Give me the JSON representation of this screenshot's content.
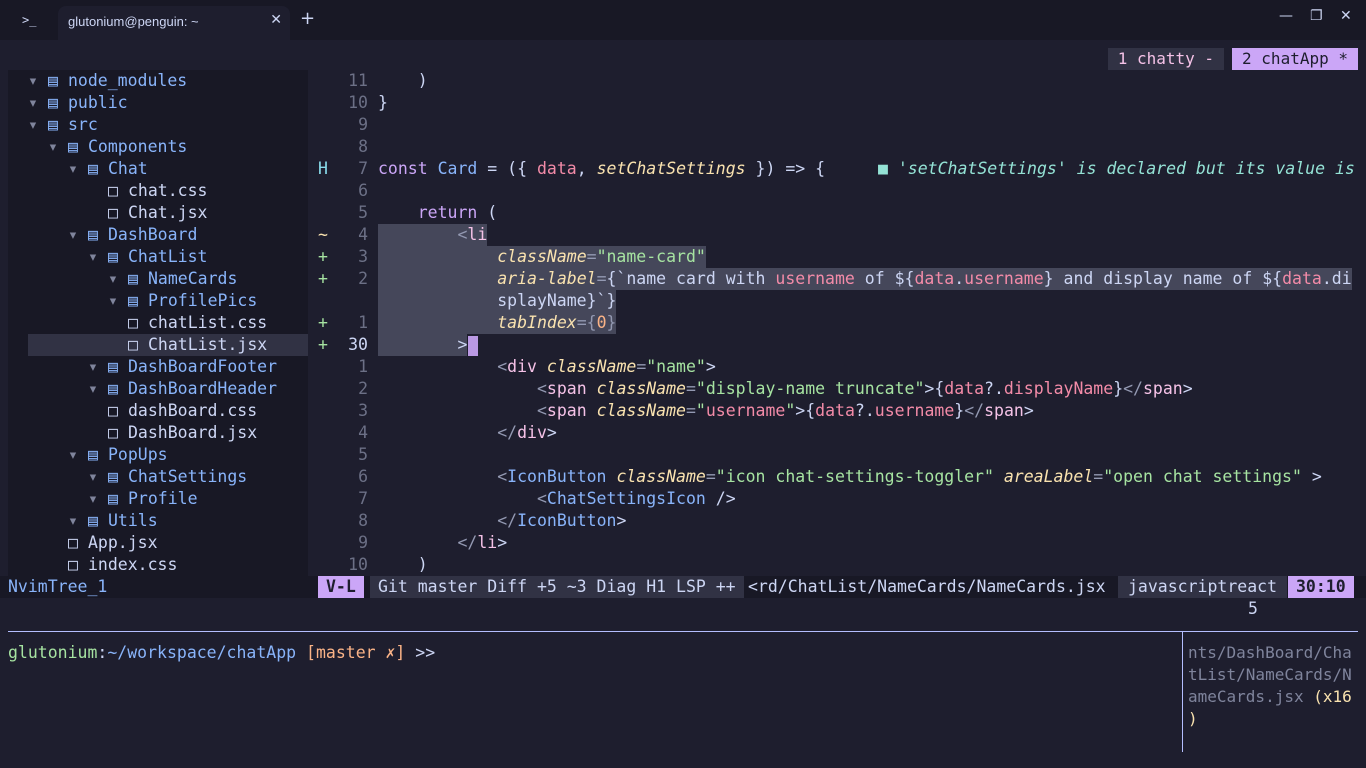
{
  "window": {
    "tab_title": "glutonium@penguin: ~",
    "terminal_icon": ">_",
    "close_glyph": "✕",
    "new_tab_glyph": "+",
    "minimize_glyph": "—",
    "maximize_glyph": "❐",
    "close_window_glyph": "✕"
  },
  "sessions": [
    {
      "label": "1 chatty -",
      "active": false
    },
    {
      "label": "2 chatApp *",
      "active": true
    }
  ],
  "tree": {
    "items": [
      {
        "arrow": "",
        "icon": "",
        "name": "node_modules",
        "type": "dir"
      },
      {
        "arrow": "",
        "icon": "",
        "name": "public",
        "type": "dir"
      },
      {
        "arrow": "",
        "icon": "",
        "name": "src",
        "type": "dir"
      },
      {
        "arrow": "",
        "icon": "",
        "name": "Components",
        "type": "dir"
      },
      {
        "arrow": "",
        "icon": "",
        "name": "Chat",
        "type": "dir"
      },
      {
        "arrow": "",
        "icon": "",
        "name": "chat.css",
        "type": "file"
      },
      {
        "arrow": "",
        "icon": "",
        "name": "Chat.jsx",
        "type": "file"
      },
      {
        "arrow": "",
        "icon": "",
        "name": "DashBoard",
        "type": "dir"
      },
      {
        "arrow": "",
        "icon": "",
        "name": "ChatList",
        "type": "dir"
      },
      {
        "arrow": "",
        "icon": "",
        "name": "NameCards",
        "type": "dir"
      },
      {
        "arrow": "",
        "icon": "",
        "name": "ProfilePics",
        "type": "dir"
      },
      {
        "arrow": "",
        "icon": "",
        "name": "chatList.css",
        "type": "file"
      },
      {
        "arrow": "",
        "icon": "",
        "name": "ChatList.jsx",
        "type": "file"
      },
      {
        "arrow": "",
        "icon": "",
        "name": "DashBoardFooter",
        "type": "dir"
      },
      {
        "arrow": "",
        "icon": "",
        "name": "DashBoardHeader",
        "type": "dir"
      },
      {
        "arrow": "",
        "icon": "",
        "name": "dashBoard.css",
        "type": "file"
      },
      {
        "arrow": "",
        "icon": "",
        "name": "DashBoard.jsx",
        "type": "file"
      },
      {
        "arrow": "",
        "icon": "",
        "name": "PopUps",
        "type": "dir"
      },
      {
        "arrow": "",
        "icon": "",
        "name": "ChatSettings",
        "type": "dir"
      },
      {
        "arrow": "",
        "icon": "",
        "name": "Profile",
        "type": "dir"
      },
      {
        "arrow": "",
        "icon": "",
        "name": "Utils",
        "type": "dir"
      },
      {
        "arrow": "",
        "icon": "",
        "name": "App.jsx",
        "type": "file"
      },
      {
        "arrow": "",
        "icon": "",
        "name": "index.css",
        "type": "file"
      }
    ]
  },
  "editor": {
    "lines": [
      {
        "sign": "",
        "num": "11",
        "code": "    )"
      },
      {
        "sign": "",
        "num": "10",
        "code": "}"
      },
      {
        "sign": "",
        "num": "9",
        "code": ""
      },
      {
        "sign": "",
        "num": "8",
        "code": ""
      },
      {
        "sign": "H",
        "num": "7",
        "code": "const Card = ({ data, setChatSettings }) => {",
        "diag_icon": "■",
        "diag": "'setChatSettings' is declared but its value is"
      },
      {
        "sign": "",
        "num": "6",
        "code": ""
      },
      {
        "sign": "",
        "num": "5",
        "code": "    return ("
      },
      {
        "sign": "~",
        "num": "4",
        "code": "        <li"
      },
      {
        "sign": "+",
        "num": "3",
        "code": "            className=\"name-card\""
      },
      {
        "sign": "+",
        "num": "2",
        "code": "            aria-label={`name card with username of ${data.username} and display name of ${data.di"
      },
      {
        "sign": "",
        "num": "",
        "code": "            splayName}`}"
      },
      {
        "sign": "+",
        "num": "1",
        "code": "            tabIndex={0}"
      },
      {
        "sign": "+",
        "num": "30",
        "code": "        >"
      },
      {
        "sign": "",
        "num": "1",
        "code": "            <div className=\"name\">"
      },
      {
        "sign": "",
        "num": "2",
        "code": "                <span className=\"display-name truncate\">{data?.displayName}</span>"
      },
      {
        "sign": "",
        "num": "3",
        "code": "                <span className=\"username\">{data?.username}</span>"
      },
      {
        "sign": "",
        "num": "4",
        "code": "            </div>"
      },
      {
        "sign": "",
        "num": "5",
        "code": ""
      },
      {
        "sign": "",
        "num": "6",
        "code": "            <IconButton className=\"icon chat-settings-toggler\" areaLabel=\"open chat settings\" >"
      },
      {
        "sign": "",
        "num": "7",
        "code": "                <ChatSettingsIcon />"
      },
      {
        "sign": "",
        "num": "8",
        "code": "            </IconButton>"
      },
      {
        "sign": "",
        "num": "9",
        "code": "        </li>"
      },
      {
        "sign": "",
        "num": "10",
        "code": "    )"
      }
    ]
  },
  "statusline": {
    "tree_name": "NvimTree_1",
    "mode": "V-L",
    "git": "Git master Diff +5 ~3 Diag H1 LSP ++",
    "path": "<rd/ChatList/NameCards/NameCards.jsx",
    "filetype": "javascriptreact",
    "position": "30:10",
    "cmd_count": "5"
  },
  "shell": {
    "user": "glutonium",
    "sep": ":",
    "path": "~/workspace/chatApp",
    "git": " [master ✗]",
    "arrow": " >>"
  },
  "side_pane": {
    "text_main": "nts/DashBoard/Cha\ntList/NameCards/N\nameCards.jsx ",
    "line_ref": "(x16\n)"
  },
  "colors": {
    "background": "#1e1e2e",
    "accent": "#cba6f7",
    "tree_bg": "#181825",
    "selection": "#45475a"
  }
}
